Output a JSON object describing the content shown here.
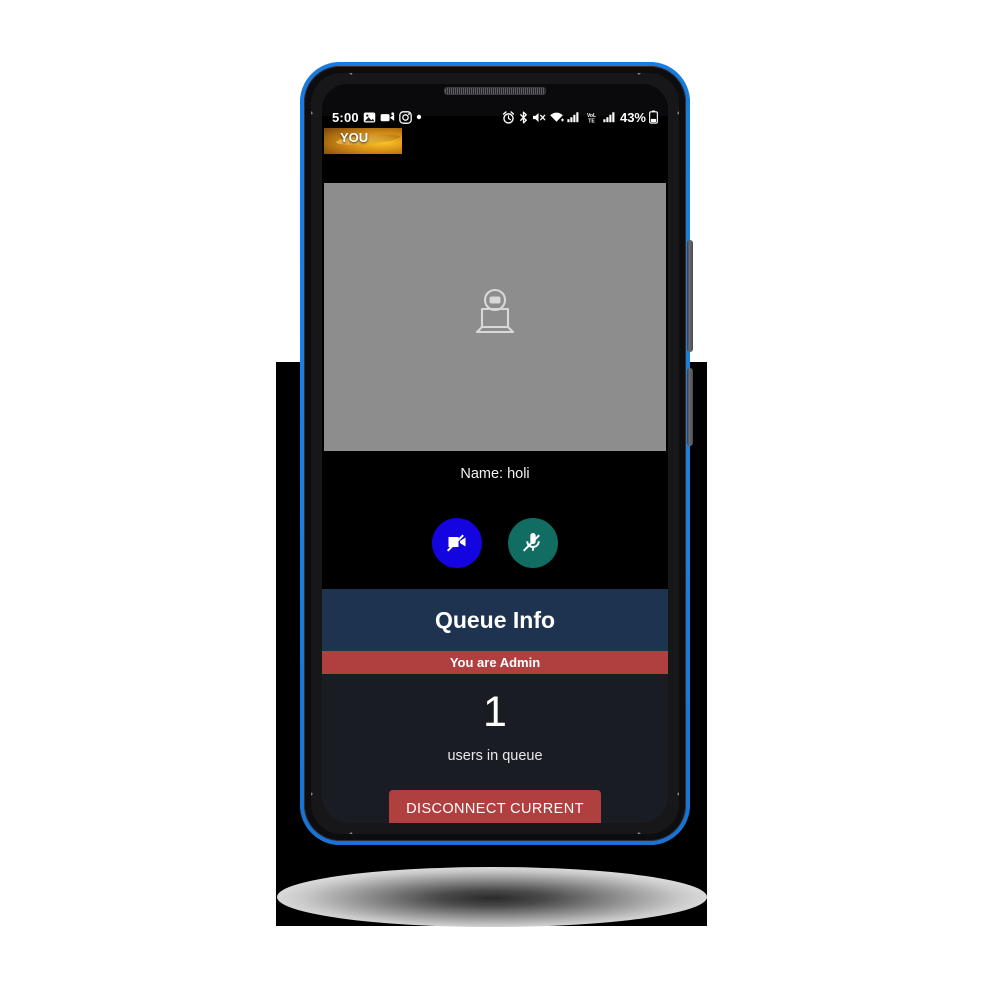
{
  "device": {
    "frame_color": "#1f7fe0",
    "bezel_color": "#0d0d0f",
    "camera_icon": "front-camera-lens",
    "earpiece_icon": "earpiece-speaker-grille"
  },
  "status_bar": {
    "clock": "5:00",
    "left_icons": [
      {
        "name": "photos-icon",
        "glyph": "photo"
      },
      {
        "name": "video-recorder-icon",
        "glyph": "camcorder"
      },
      {
        "name": "instagram-icon",
        "glyph": "instagram"
      },
      {
        "name": "more-notifications-dot",
        "glyph": "dot"
      }
    ],
    "right_icons": [
      {
        "name": "alarm-icon",
        "glyph": "alarm"
      },
      {
        "name": "bluetooth-icon",
        "glyph": "bluetooth"
      },
      {
        "name": "mute-icon",
        "glyph": "mute"
      },
      {
        "name": "wifi-icon",
        "glyph": "wifi"
      },
      {
        "name": "signal-sim1-icon",
        "glyph": "bars"
      },
      {
        "name": "volte-icon",
        "glyph": "volte"
      },
      {
        "name": "signal-sim2-icon",
        "glyph": "bars"
      }
    ],
    "volte_label": "VoLTE",
    "battery_percent": "43%"
  },
  "app": {
    "self_view": {
      "label": "YOU"
    },
    "remote_video": {
      "placeholder_icon": "webcam-laptop-icon"
    },
    "participant": {
      "name_line": "Name: holi"
    },
    "controls": [
      {
        "name": "toggle-video-button",
        "icon": "video-off-icon",
        "color": "#1405e0",
        "state": "off"
      },
      {
        "name": "toggle-mic-button",
        "icon": "mic-off-icon",
        "color": "#116c62",
        "state": "off"
      }
    ],
    "queue": {
      "title": "Queue Info",
      "admin_badge": "You are Admin",
      "count": "1",
      "count_label": "users in queue",
      "disconnect_label": "DISCONNECT CURRENT",
      "header_color": "#1d3350",
      "badge_color": "#b03f3f",
      "panel_color": "#191c23"
    }
  },
  "nav_bar": {
    "buttons": [
      {
        "name": "nav-back-button",
        "icon": "back-chevron-icon"
      },
      {
        "name": "nav-home-button",
        "icon": "home-pill-icon"
      },
      {
        "name": "nav-recents-button",
        "icon": "recents-bars-icon"
      }
    ]
  }
}
